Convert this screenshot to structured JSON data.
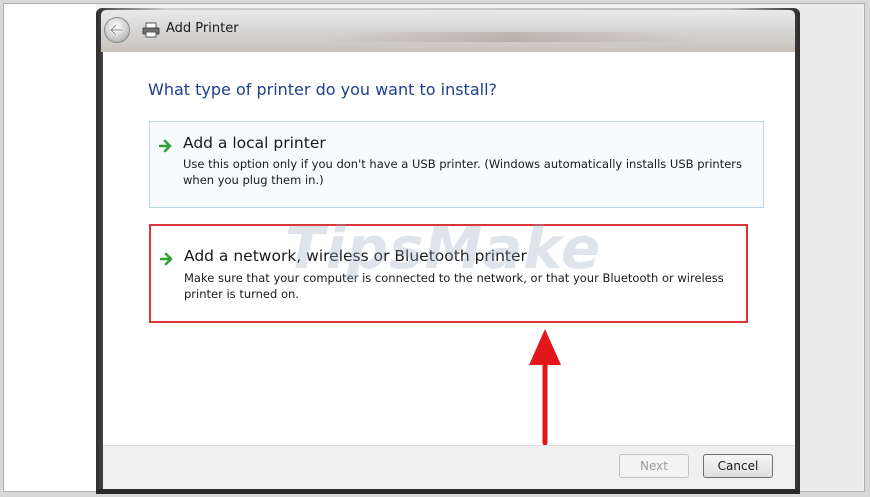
{
  "window": {
    "title": "Add Printer"
  },
  "page": {
    "question": "What type of printer do you want to install?"
  },
  "options": [
    {
      "title": "Add a local printer",
      "description": "Use this option only if you don't have a USB printer. (Windows automatically installs USB printers when you plug them in.)"
    },
    {
      "title": "Add a network, wireless or Bluetooth printer",
      "description": "Make sure that your computer is connected to the network, or that your Bluetooth or wireless printer is turned on."
    }
  ],
  "buttons": {
    "next": "Next",
    "cancel": "Cancel"
  },
  "watermark": "TipsMake",
  "colors": {
    "heading": "#1e3f8a",
    "option_arrow": "#2fa12f",
    "highlight_border": "#d9353a",
    "annotation_arrow": "#e3161c"
  },
  "icons": {
    "back": "back-arrow-icon",
    "window": "printer-icon",
    "option": "green-arrow-icon"
  }
}
